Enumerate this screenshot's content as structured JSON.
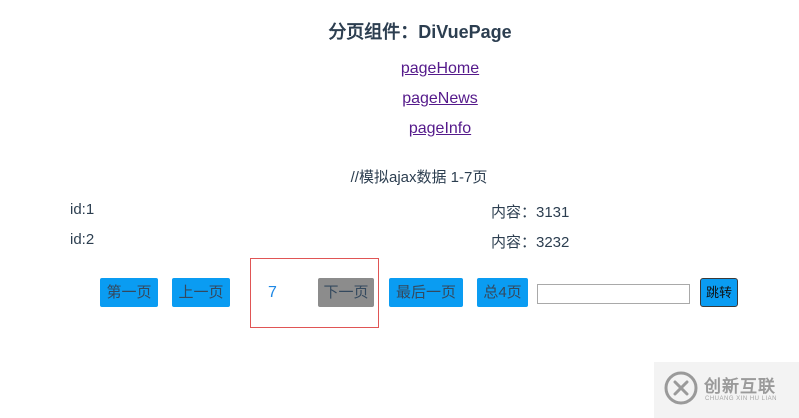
{
  "header": {
    "title": "分页组件：DiVuePage"
  },
  "nav": {
    "links": [
      {
        "label": "pageHome"
      },
      {
        "label": "pageNews"
      },
      {
        "label": "pageInfo"
      }
    ]
  },
  "comment": "//模拟ajax数据 1-7页",
  "rows": [
    {
      "id": "id:1",
      "content": "内容：3131"
    },
    {
      "id": "id:2",
      "content": "内容：3232"
    }
  ],
  "pagination": {
    "first_label": "第一页",
    "prev_label": "上一页",
    "current_page": "7",
    "next_label": "下一页",
    "last_label": "最后一页",
    "total_label": "总4页",
    "jump_input_value": "",
    "jump_label": "跳转"
  },
  "watermark": {
    "text": "创新互联",
    "subtext": "CHUANG XIN HU LIAN"
  },
  "colors": {
    "button_blue": "#0a9cf2",
    "button_disabled": "#8c8c8c",
    "highlight_border": "#e05555",
    "link_visited": "#551a8b"
  }
}
